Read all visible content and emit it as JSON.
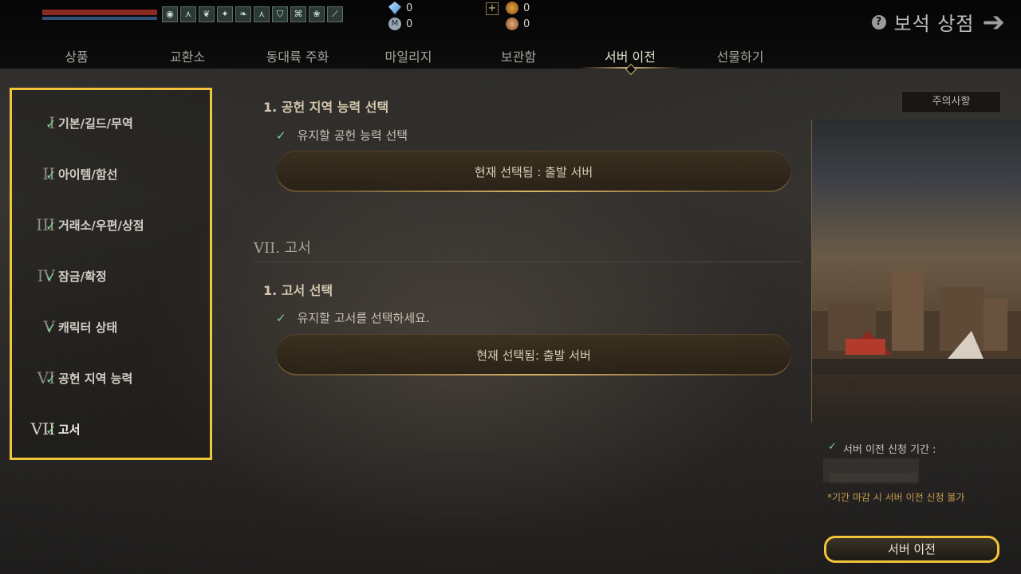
{
  "header": {
    "currencies": [
      {
        "icon": "diamond-icon",
        "value": "0"
      },
      {
        "icon": "m-coin-icon",
        "value": "0"
      },
      {
        "icon": "gold-coin-icon",
        "value": "0"
      },
      {
        "icon": "bronze-coin-icon",
        "value": "0"
      }
    ],
    "add_label": "+",
    "shop_title": "보석 상점",
    "help_label": "?",
    "tabs": [
      {
        "label": "상품"
      },
      {
        "label": "교환소"
      },
      {
        "label": "동대륙 주화"
      },
      {
        "label": "마일리지"
      },
      {
        "label": "보관함"
      },
      {
        "label": "서버 이전",
        "active": true
      },
      {
        "label": "선물하기"
      }
    ]
  },
  "sidebar": {
    "items": [
      {
        "roman": "I",
        "label": "기본/길드/무역"
      },
      {
        "roman": "II",
        "label": "아이템/함선"
      },
      {
        "roman": "III",
        "label": "거래소/우편/상점"
      },
      {
        "roman": "IV",
        "label": "잠금/확정"
      },
      {
        "roman": "V",
        "label": "캐릭터 상태"
      },
      {
        "roman": "VI",
        "label": "공헌 지역 능력"
      },
      {
        "roman": "VII",
        "label": "고서",
        "active": true
      }
    ]
  },
  "main": {
    "block1": {
      "heading": "1. 공헌 지역 능력 선택",
      "check_text": "유지할 공헌 능력 선택",
      "button": "현재 선택됨 : 출발 서버"
    },
    "section_title": "VII. 고서",
    "block2": {
      "heading": "1. 고서 선택",
      "check_text": "유지할 고서를 선택하세요.",
      "button": "현재 선택됨: 출발 서버"
    }
  },
  "right_panel": {
    "notice_button": "주의사항",
    "period_label": "서버 이전 신청 기간 :",
    "warning": "*기간 마감 시 서버 이전 신청 불가",
    "transfer_button": "서버 이전"
  },
  "colors": {
    "highlight": "#f2c43a",
    "check": "#7fcf8f",
    "warning": "#c79a4c"
  }
}
